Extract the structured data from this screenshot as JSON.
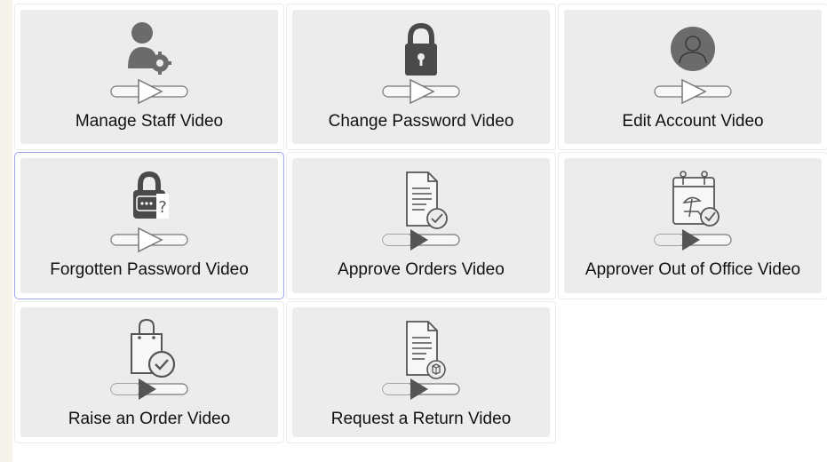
{
  "videos": [
    {
      "label": "Manage Staff Video",
      "icon": "manage-staff-icon"
    },
    {
      "label": "Change Password Video",
      "icon": "padlock-icon"
    },
    {
      "label": "Edit Account Video",
      "icon": "user-avatar-icon"
    },
    {
      "label": "Forgotten Password Video",
      "icon": "forgotten-password-icon"
    },
    {
      "label": "Approve Orders Video",
      "icon": "document-check-icon"
    },
    {
      "label": "Approver Out of Office Video",
      "icon": "calendar-holiday-icon"
    },
    {
      "label": "Raise an Order Video",
      "icon": "shopping-bag-check-icon"
    },
    {
      "label": "Request a Return Video",
      "icon": "document-return-icon"
    }
  ],
  "colors": {
    "card_background": "#ececec",
    "icon_grey": "#6b6b6b",
    "focus_border": "#9ea3f2",
    "page_background": "#f5f2ea"
  }
}
